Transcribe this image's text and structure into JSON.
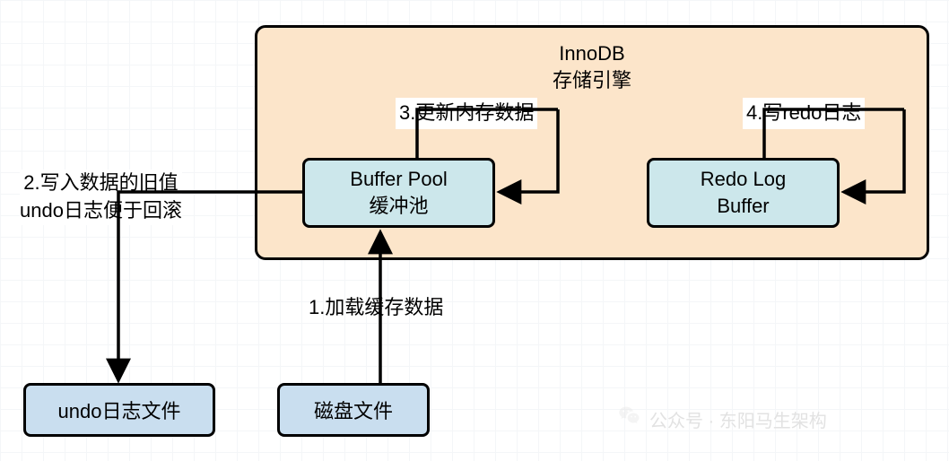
{
  "innodb": {
    "title_line1": "InnoDB",
    "title_line2": "存储引擎",
    "buffer_pool_line1": "Buffer Pool",
    "buffer_pool_line2": "缓冲池",
    "redo_log_line1": "Redo Log",
    "redo_log_line2": "Buffer"
  },
  "bottom": {
    "undo_file": "undo日志文件",
    "disk_file": "磁盘文件"
  },
  "labels": {
    "step1": "1.加载缓存数据",
    "step2_line1": "2.写入数据的旧值",
    "step2_line2": "undo日志便于回滚",
    "step3": "3.更新内存数据",
    "step4": "4.写redo日志"
  },
  "watermark": {
    "text": "公众号 · 东阳马生架构"
  }
}
